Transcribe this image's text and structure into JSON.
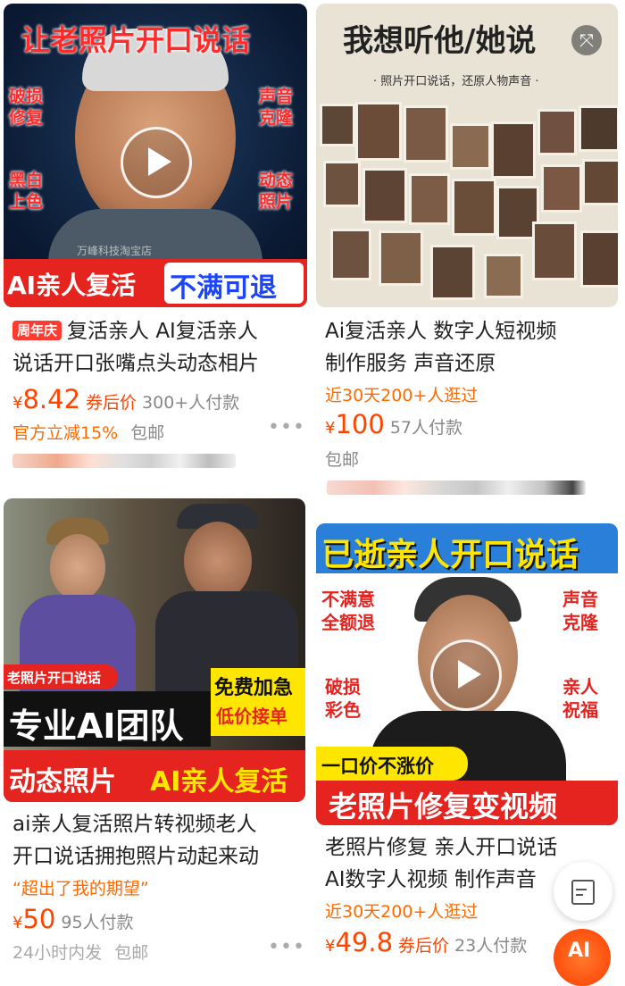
{
  "cards": [
    {
      "thumb": {
        "headline": "让老照片开口说话",
        "left_labels": [
          "破损\n修复",
          "黑白\n上色"
        ],
        "right_labels": [
          "声音\n克隆",
          "动态\n照片"
        ],
        "banner_left": "AI亲人复活",
        "banner_right": "不满可退",
        "watermark": "万峰科技淘宝店"
      },
      "tag": "周年庆",
      "title_line1": "复活亲人 AI复活亲人",
      "title_line2": "说话开口张嘴点头动态相片",
      "price_symbol": "¥",
      "price": "8.42",
      "coupon": "券后价",
      "paid": "300+人付款",
      "promo": "官方立减15%",
      "shipping": "包邮"
    },
    {
      "thumb": {
        "headline": "我想听他/她说",
        "subtitle": "· 照片开口说话，还原人物声音 ·"
      },
      "title_line1": "Ai复活亲人 数字人短视频",
      "title_line2": "制作服务 声音还原",
      "visits": "近30天200+人逛过",
      "price_symbol": "¥",
      "price": "100",
      "paid": "57人付款",
      "shipping": "包邮"
    },
    {
      "thumb": {
        "badge": "老照片开口说话",
        "team": "专业AI团队",
        "right_box_line1": "免费加急",
        "right_box_line2": "低价接单",
        "footer_left": "动态照片",
        "footer_right": "AI亲人复活"
      },
      "title_line1": "ai亲人复活照片转视频老人",
      "title_line2": "开口说话拥抱照片动起来动",
      "quote": "“超出了我的期望”",
      "price_symbol": "¥",
      "price": "50",
      "paid": "95人付款",
      "delivery": "24小时内发",
      "shipping": "包邮"
    },
    {
      "thumb": {
        "headline": "已逝亲人开口说话",
        "left_labels": [
          "不满意\n全额退",
          "破损\n彩色"
        ],
        "right_labels": [
          "声音\n克隆",
          "亲人\n祝福"
        ],
        "price_badge": "一口价不涨价",
        "footer": "老照片修复变视频"
      },
      "title_line1": "老照片修复 亲人开口说话",
      "title_line2": "AI数字人视频 制作声音",
      "visits": "近30天200+人逛过",
      "price_symbol": "¥",
      "price": "49.8",
      "coupon": "券后价",
      "paid": "23人付款"
    }
  ],
  "floating": {
    "edit_icon": "edit-icon",
    "ai_badge": "AI"
  },
  "colors": {
    "price": "#ff4400",
    "accent_red": "#e52420",
    "accent_yellow": "#ffe600"
  }
}
